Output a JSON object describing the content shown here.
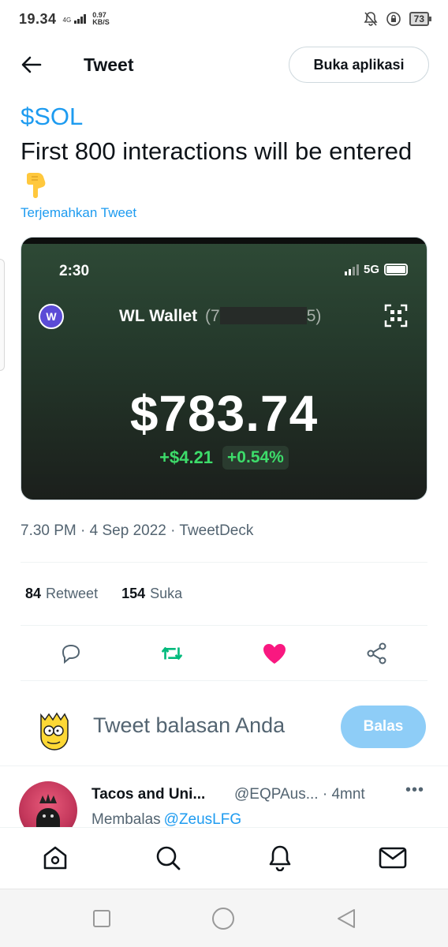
{
  "status_bar": {
    "time": "19.34",
    "network": "4G",
    "speed_value": "0.97",
    "speed_unit": "KB/S",
    "battery": "73"
  },
  "header": {
    "title": "Tweet",
    "open_app_label": "Buka aplikasi"
  },
  "tweet": {
    "cashtag": "$SOL",
    "text_line": "First 800 interactions will be entered",
    "translate_label": "Terjemahkan Tweet",
    "media": {
      "phone_time": "2:30",
      "phone_network": "5G",
      "wallet_avatar_letter": "W",
      "wallet_name": "WL Wallet",
      "wallet_addr_open": "(7",
      "wallet_addr_close": "5)",
      "balance": "$783.74",
      "change_abs": "+$4.21",
      "change_pct": "+0.54%"
    },
    "meta": "7.30 PM · 4 Sep 2022 · TweetDeck",
    "retweets_count": "84",
    "retweets_label": "Retweet",
    "likes_count": "154",
    "likes_label": "Suka"
  },
  "composer": {
    "placeholder": "Tweet balasan Anda",
    "reply_button": "Balas"
  },
  "reply": {
    "name": "Tacos and Uni...",
    "handle": "@EQPAus... · 4mnt",
    "more": "•••",
    "replying_label": "Membalas",
    "replying_to": "@ZeusLFG"
  },
  "colors": {
    "accent": "#1d9bf0",
    "retweet": "#00ba7c",
    "like": "#f91880",
    "positive": "#3ddc6a"
  },
  "icons": {
    "back": "arrow-left-icon",
    "reply": "comment-icon",
    "retweet": "retweet-icon",
    "like": "heart-icon",
    "share": "share-icon",
    "home": "home-icon",
    "search": "search-icon",
    "notifications": "bell-icon",
    "messages": "mail-icon"
  }
}
